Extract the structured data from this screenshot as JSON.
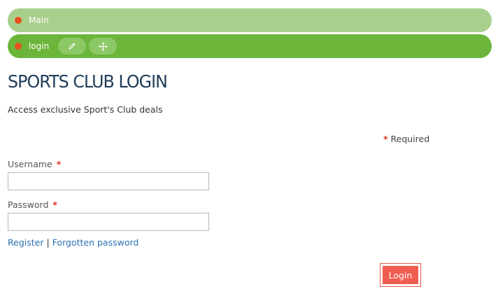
{
  "breadcrumb": {
    "items": [
      {
        "label": "Main"
      },
      {
        "label": "login"
      }
    ],
    "tools": [
      {
        "icon": "pencil-icon"
      },
      {
        "icon": "move-icon"
      }
    ]
  },
  "page": {
    "title": "SPORTS CLUB LOGIN",
    "subtitle": "Access exclusive Sport's Club deals",
    "required_marker": "*",
    "required_label": "Required"
  },
  "form": {
    "username_label": "Username",
    "username_value": "",
    "password_label": "Password",
    "password_value": "",
    "register_link": "Register",
    "separator": "|",
    "forgot_link": "Forgotten password",
    "login_button": "Login"
  },
  "colors": {
    "breadcrumb_main_bg": "#a9cf8c",
    "breadcrumb_login_bg": "#6bb53a",
    "dot": "#e8501e",
    "title": "#1f3b57",
    "link": "#2a6fb0",
    "required_asterisk": "#e0301e",
    "login_button": "#ef5d50"
  }
}
